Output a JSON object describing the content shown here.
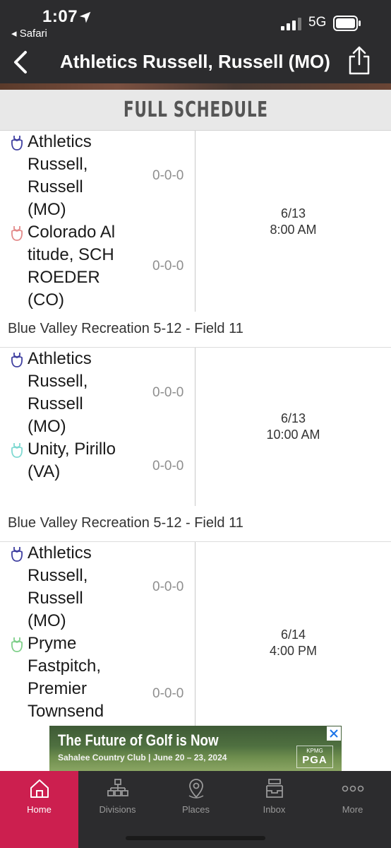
{
  "status_bar": {
    "time": "1:07",
    "back_app_label": "◂ Safari",
    "network": "5G"
  },
  "header": {
    "title": "Athletics Russell, Russell  (MO)"
  },
  "section": {
    "title": "FULL SCHEDULE"
  },
  "games": [
    {
      "teams": [
        {
          "name": "Athletics Russell, Russell (MO)",
          "record": "0-0-0",
          "icon_color": "#3f3fa0"
        },
        {
          "name": "Colorado Altitude, SCHROEDER (CO)",
          "record": "0-0-0",
          "icon_color": "#e38a8a"
        }
      ],
      "date": "6/13",
      "time": "8:00 AM",
      "venue": "Blue Valley Recreation 5-12 - Field 11"
    },
    {
      "teams": [
        {
          "name": "Athletics Russell, Russell (MO)",
          "record": "0-0-0",
          "icon_color": "#3f3fa0"
        },
        {
          "name": "Unity, Pirillo (VA)",
          "record": "0-0-0",
          "icon_color": "#7fd9d2"
        }
      ],
      "date": "6/13",
      "time": "10:00 AM",
      "venue": "Blue Valley Recreation 5-12 - Field 11"
    },
    {
      "teams": [
        {
          "name": "Athletics Russell, Russell (MO)",
          "record": "0-0-0",
          "icon_color": "#3f3fa0"
        },
        {
          "name": "Pryme Fastpitch, Premier Townsend",
          "record": "0-0-0",
          "icon_color": "#7fcf8a"
        }
      ],
      "date": "6/14",
      "time": "4:00 PM"
    }
  ],
  "ad": {
    "headline": "The Future of Golf is Now",
    "subline": "Sahalee Country Club | June 20 – 23, 2024",
    "logo_text": "PGA",
    "logo_small": "KPMG"
  },
  "tabbar": {
    "active_color": "#cc1f4f",
    "items": [
      {
        "label": "Home",
        "icon": "home-icon"
      },
      {
        "label": "Divisions",
        "icon": "bracket-icon"
      },
      {
        "label": "Places",
        "icon": "map-pin-icon"
      },
      {
        "label": "Inbox",
        "icon": "inbox-icon"
      },
      {
        "label": "More",
        "icon": "more-dots-icon"
      }
    ]
  }
}
